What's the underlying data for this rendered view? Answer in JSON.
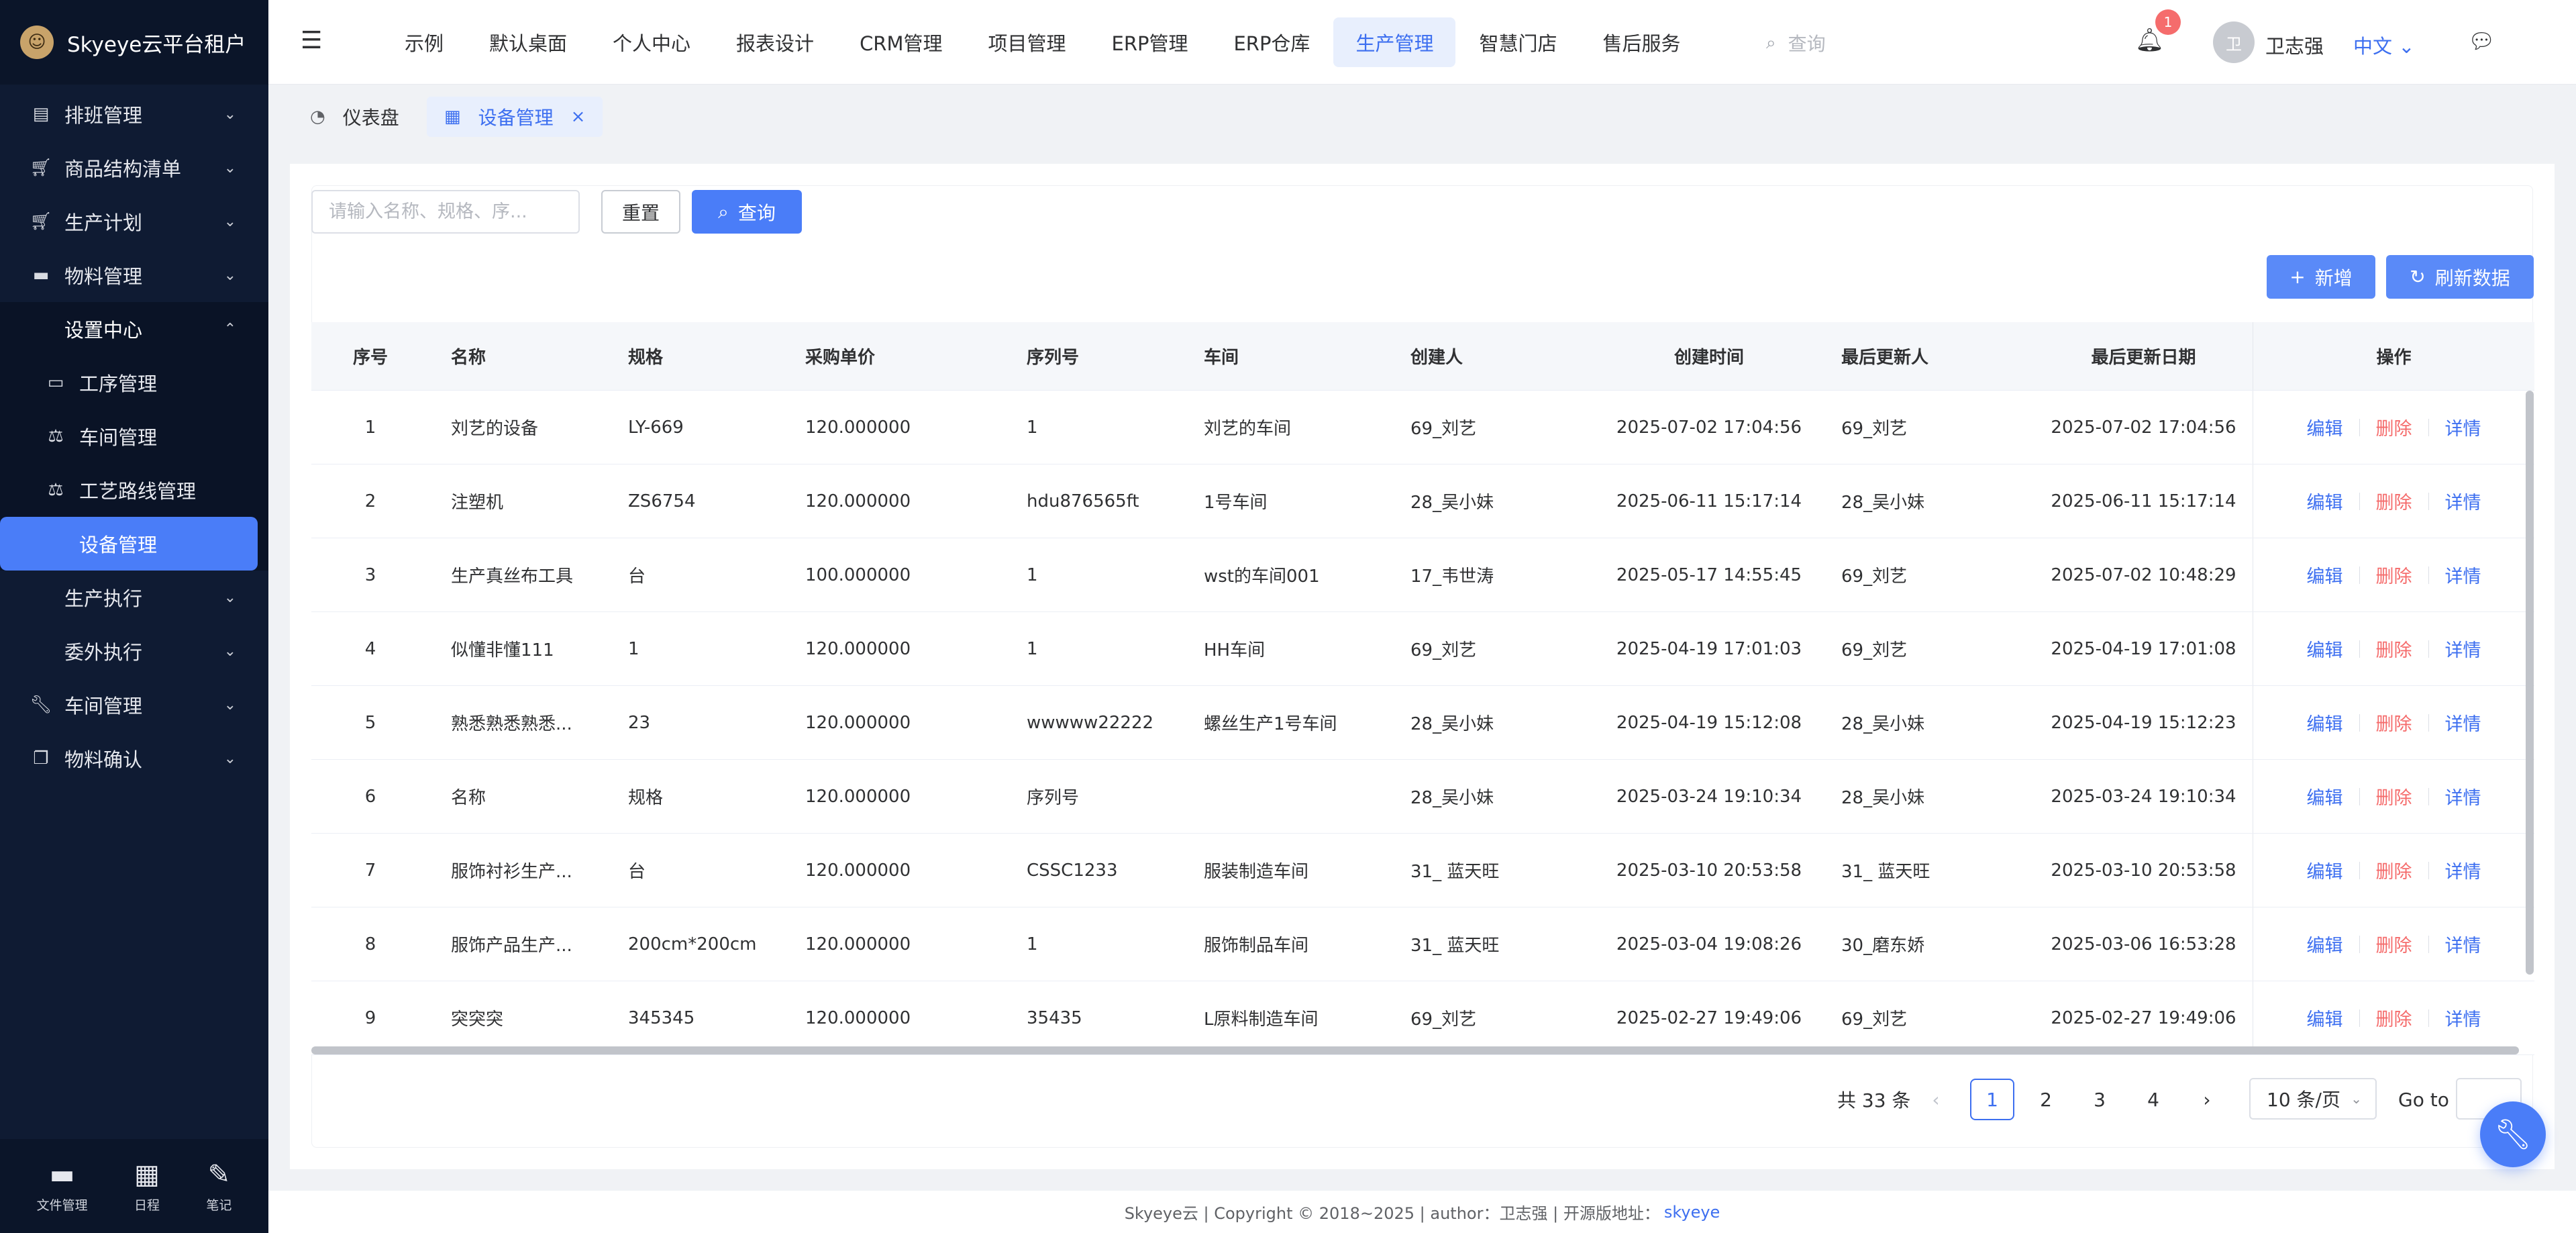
{
  "brand": {
    "name": "Skyeye云平台租户",
    "logo_char": "☺"
  },
  "sidebar": {
    "items": [
      {
        "label": "排班管理",
        "icon": "clipboard-icon"
      },
      {
        "label": "商品结构清单",
        "icon": "cart-icon"
      },
      {
        "label": "生产计划",
        "icon": "cart-icon"
      },
      {
        "label": "物料管理",
        "icon": "folder-icon"
      },
      {
        "label": "设置中心",
        "icon": ""
      },
      {
        "label": "工序管理",
        "icon": "folder-open-icon"
      },
      {
        "label": "车间管理",
        "icon": "scale-icon"
      },
      {
        "label": "工艺路线管理",
        "icon": "scale-icon"
      },
      {
        "label": "设备管理",
        "icon": ""
      },
      {
        "label": "生产执行",
        "icon": ""
      },
      {
        "label": "委外执行",
        "icon": ""
      },
      {
        "label": "车间管理",
        "icon": "wrench-icon"
      },
      {
        "label": "物料确认",
        "icon": "copy-icon"
      }
    ],
    "footer": [
      {
        "label": "文件管理",
        "icon": "folder-icon"
      },
      {
        "label": "日程",
        "icon": "calendar-icon"
      },
      {
        "label": "笔记",
        "icon": "edit-icon"
      }
    ]
  },
  "topnav": {
    "items": [
      "示例",
      "默认桌面",
      "个人中心",
      "报表设计",
      "CRM管理",
      "项目管理",
      "ERP管理",
      "ERP仓库",
      "生产管理",
      "智慧门店",
      "售后服务"
    ],
    "active": "生产管理",
    "search_placeholder": "查询",
    "notification_count": "1",
    "avatar_char": "卫",
    "username": "卫志强",
    "language": "中文"
  },
  "tabs": [
    {
      "label": "仪表盘",
      "icon": "dashboard-icon"
    },
    {
      "label": "设备管理",
      "icon": "grid-icon",
      "active": true
    }
  ],
  "toolbar": {
    "search_placeholder": "请输入名称、规格、序...",
    "reset_label": "重置",
    "query_label": "查询",
    "add_label": "新增",
    "refresh_label": "刷新数据"
  },
  "table": {
    "headers": [
      "序号",
      "名称",
      "规格",
      "采购单价",
      "序列号",
      "车间",
      "创建人",
      "创建时间",
      "最后更新人",
      "最后更新日期",
      "操作"
    ],
    "actions": {
      "edit": "编辑",
      "delete": "删除",
      "detail": "详情"
    },
    "rows": [
      [
        "1",
        "刘艺的设备",
        "LY-669",
        "120.000000",
        "1",
        "刘艺的车间",
        "69_刘艺",
        "2025-07-02 17:04:56",
        "69_刘艺",
        "2025-07-02 17:04:56"
      ],
      [
        "2",
        "注塑机",
        "ZS6754",
        "120.000000",
        "hdu876565ft",
        "1号车间",
        "28_吴小妹",
        "2025-06-11 15:17:14",
        "28_吴小妹",
        "2025-06-11 15:17:14"
      ],
      [
        "3",
        "生产真丝布工具",
        "台",
        "100.000000",
        "1",
        "wst的车间001",
        "17_韦世涛",
        "2025-05-17 14:55:45",
        "69_刘艺",
        "2025-07-02 10:48:29"
      ],
      [
        "4",
        "似懂非懂111",
        "1",
        "120.000000",
        "1",
        "HH车间",
        "69_刘艺",
        "2025-04-19 17:01:03",
        "69_刘艺",
        "2025-04-19 17:01:08"
      ],
      [
        "5",
        "熟悉熟悉熟悉...",
        "23",
        "120.000000",
        "wwwww22222",
        "螺丝生产1号车间",
        "28_吴小妹",
        "2025-04-19 15:12:08",
        "28_吴小妹",
        "2025-04-19 15:12:23"
      ],
      [
        "6",
        "名称",
        "规格",
        "120.000000",
        "序列号",
        "",
        "28_吴小妹",
        "2025-03-24 19:10:34",
        "28_吴小妹",
        "2025-03-24 19:10:34"
      ],
      [
        "7",
        "服饰衬衫生产...",
        "台",
        "120.000000",
        "CSSC1233",
        "服装制造车间",
        "31_ 蓝天旺",
        "2025-03-10 20:53:58",
        "31_ 蓝天旺",
        "2025-03-10 20:53:58"
      ],
      [
        "8",
        "服饰产品生产...",
        "200cm*200cm",
        "120.000000",
        "1",
        "服饰制品车间",
        "31_ 蓝天旺",
        "2025-03-04 19:08:26",
        "30_磨东娇",
        "2025-03-06 16:53:28"
      ],
      [
        "9",
        "突突突",
        "345345",
        "120.000000",
        "35435",
        "L原料制造车间",
        "69_刘艺",
        "2025-02-27 19:49:06",
        "69_刘艺",
        "2025-02-27 19:49:06"
      ]
    ]
  },
  "pagination": {
    "total": "共 33 条",
    "pages": [
      "1",
      "2",
      "3",
      "4"
    ],
    "current": "1",
    "page_size": "10 条/页",
    "goto_label": "Go to"
  },
  "footer": {
    "text": "Skyeye云 | Copyright © 2018~2025 | author：卫志强 | 开源版地址：",
    "link": "skyeye"
  }
}
